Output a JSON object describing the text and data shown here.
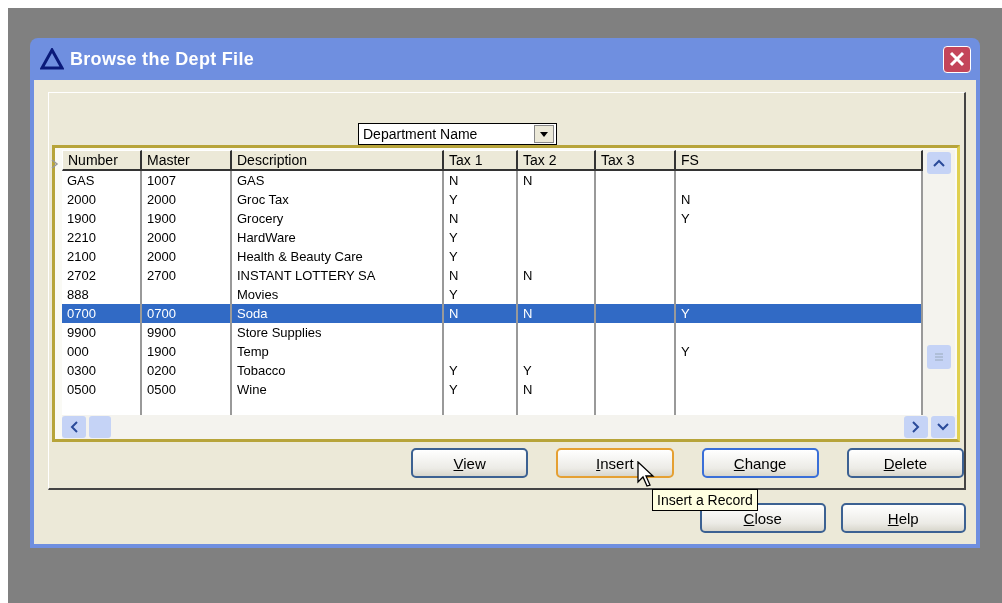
{
  "window": {
    "title": "Browse the Dept File"
  },
  "sort_dropdown": {
    "value": "Department Name"
  },
  "table": {
    "columns": [
      "Number",
      "Master",
      "Description",
      "Tax 1",
      "Tax 2",
      "Tax 3",
      "FS"
    ],
    "rows": [
      {
        "cells": [
          "GAS",
          "1007",
          "GAS",
          "N",
          "N",
          "",
          ""
        ],
        "selected": false
      },
      {
        "cells": [
          "2000",
          "2000",
          "Groc Tax",
          "Y",
          "",
          "",
          "N"
        ],
        "selected": false
      },
      {
        "cells": [
          "1900",
          "1900",
          "Grocery",
          "N",
          "",
          "",
          "Y"
        ],
        "selected": false
      },
      {
        "cells": [
          "2210",
          "2000",
          "HardWare",
          "Y",
          "",
          "",
          ""
        ],
        "selected": false
      },
      {
        "cells": [
          "2100",
          "2000",
          "Health & Beauty Care",
          "Y",
          "",
          "",
          ""
        ],
        "selected": false
      },
      {
        "cells": [
          "2702",
          "2700",
          "INSTANT LOTTERY SA",
          "N",
          "N",
          "",
          ""
        ],
        "selected": false
      },
      {
        "cells": [
          "888",
          "",
          "Movies",
          "Y",
          "",
          "",
          ""
        ],
        "selected": false
      },
      {
        "cells": [
          "0700",
          "0700",
          "Soda",
          "N",
          "N",
          "",
          "Y"
        ],
        "selected": true
      },
      {
        "cells": [
          "9900",
          "9900",
          "Store Supplies",
          "",
          "",
          "",
          ""
        ],
        "selected": false
      },
      {
        "cells": [
          "000",
          "1900",
          "Temp",
          "",
          "",
          "",
          "Y"
        ],
        "selected": false
      },
      {
        "cells": [
          "0300",
          "0200",
          "Tobacco",
          "Y",
          "Y",
          "",
          ""
        ],
        "selected": false
      },
      {
        "cells": [
          "0500",
          "0500",
          "Wine",
          "Y",
          "N",
          "",
          ""
        ],
        "selected": false
      }
    ]
  },
  "action_buttons": [
    {
      "label": "View",
      "hotkey": true,
      "hovered": false,
      "focused": false
    },
    {
      "label": "Insert",
      "hotkey": true,
      "hovered": true,
      "focused": false
    },
    {
      "label": "Change",
      "hotkey": true,
      "hovered": false,
      "focused": true
    },
    {
      "label": "Delete",
      "hotkey": true,
      "hovered": false,
      "focused": false
    }
  ],
  "dialog_buttons": [
    {
      "label": "Close",
      "hotkey": true,
      "hovered": false,
      "focused": false
    },
    {
      "label": "Help",
      "hotkey": true,
      "hovered": false,
      "focused": false
    }
  ],
  "tooltip": {
    "text": "Insert a Record"
  }
}
